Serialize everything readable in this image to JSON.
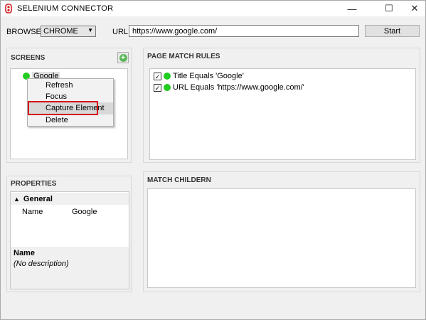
{
  "window": {
    "title": "SELENIUM CONNECTOR",
    "minimize": "—",
    "maximize": "☐",
    "close": "✕"
  },
  "toolbar": {
    "browser_label": "BROWSER",
    "browser_value": "CHROME",
    "url_label": "URL",
    "url_value": "https://www.google.com/",
    "start_label": "Start"
  },
  "screens": {
    "header": "SCREENS",
    "add_icon": "plus-circle-icon",
    "items": [
      {
        "label": "Google",
        "status_color": "#22cc22"
      }
    ]
  },
  "context_menu": {
    "items": [
      "Refresh",
      "Focus",
      "Capture Element",
      "Delete"
    ],
    "highlighted": "Capture Element"
  },
  "page_match_rules": {
    "header": "PAGE MATCH RULES",
    "rules": [
      {
        "checked": true,
        "text": "Title Equals 'Google'"
      },
      {
        "checked": true,
        "text": "URL Equals 'https://www.google.com/'"
      }
    ]
  },
  "match_children": {
    "header": "MATCH CHILDERN"
  },
  "properties": {
    "header": "PROPERTIES",
    "section": "General",
    "rows": [
      {
        "name": "Name",
        "value": "Google"
      }
    ],
    "description_title": "Name",
    "description_text": "(No description)"
  },
  "colors": {
    "status_green": "#22cc22",
    "highlight_border": "#d40000",
    "add_green": "#5cb85c"
  }
}
